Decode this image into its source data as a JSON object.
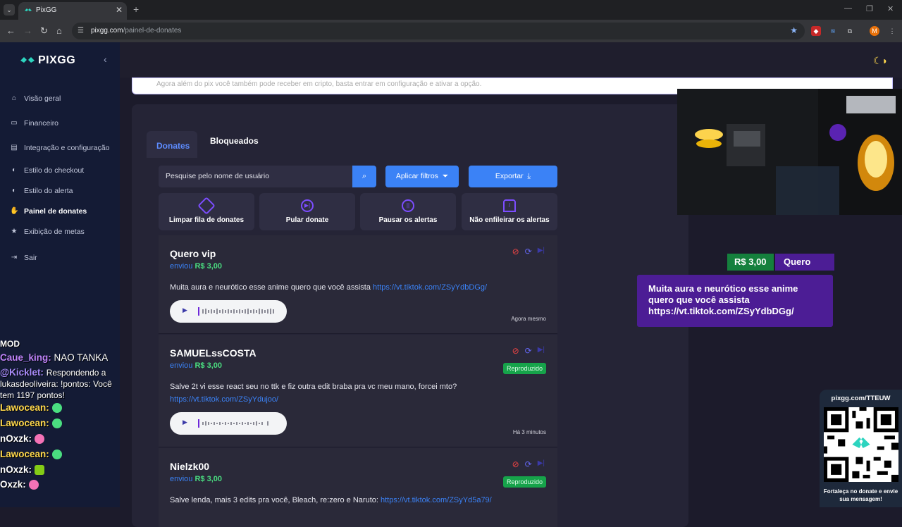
{
  "browser": {
    "tab_title": "PixGG",
    "tab_close": "✕",
    "new_tab": "+",
    "url_domain": "pixgg.com",
    "url_path": "/painel-de-donates",
    "window_minimize": "—",
    "window_restore": "❐",
    "window_close": "✕",
    "profile_initial": "M"
  },
  "sidebar": {
    "brand": "PIXGG",
    "items": [
      {
        "label": "Visão geral",
        "icon": "home-icon"
      },
      {
        "label": "Financeiro",
        "icon": "wallet-icon"
      },
      {
        "label": "Integração e configuração",
        "icon": "settings-icon"
      },
      {
        "label": "Estilo do checkout",
        "icon": "palette-icon"
      },
      {
        "label": "Estilo do alerta",
        "icon": "palette-icon"
      },
      {
        "label": "Painel de donates",
        "icon": "hand-coin-icon"
      },
      {
        "label": "Exibição de metas",
        "icon": "star-icon"
      },
      {
        "label": "Sair",
        "icon": "logout-icon"
      }
    ]
  },
  "chat": {
    "lines": [
      {
        "user": "MOD",
        "text": ""
      },
      {
        "user": "Caue_king:",
        "text": "NAO TANKA"
      },
      {
        "user": "@Kicklet:",
        "text": "Respondendo a lukasdeoliveira: !pontos: Você tem 1197 pontos!"
      },
      {
        "user": "Lawocean:",
        "text": ""
      },
      {
        "user": "Lawocean:",
        "text": ""
      },
      {
        "user": "nOxzk:",
        "text": ""
      },
      {
        "user": "Lawocean:",
        "text": ""
      },
      {
        "user": "nOxzk:",
        "text": ""
      },
      {
        "user": "Oxzk:",
        "text": ""
      }
    ]
  },
  "main": {
    "notice": "Agora além do pix você também pode receber em cripto, basta entrar em configuração e ativar a opção.",
    "tabs": {
      "donates": "Donates",
      "blocked": "Bloqueados"
    },
    "search_placeholder": "Pesquise pelo nome de usuário",
    "filters_label": "Aplicar filtros",
    "export_label": "Exportar",
    "actions": [
      {
        "label": "Limpar fila de donates",
        "icon": "eraser-icon"
      },
      {
        "label": "Pular donate",
        "icon": "skip-icon"
      },
      {
        "label": "Pausar os alertas",
        "icon": "pause-icon"
      },
      {
        "label": "Não enfileirar os alertas",
        "icon": "bell-off-icon"
      }
    ],
    "donates": [
      {
        "name": "Quero vip",
        "sent": "enviou",
        "amount": "R$ 3,00",
        "message": "Muita aura e neurótico esse anime quero que você assista",
        "link": "https://vt.tiktok.com/ZSyYdbDGg/",
        "status": "",
        "time": "Agora mesmo"
      },
      {
        "name": "SAMUELssCOSTA",
        "sent": "enviou",
        "amount": "R$ 3,00",
        "message": "Salve 2t vi esse react seu no ttk e fiz outra edit braba pra vc meu mano, forcei mto?",
        "link": "https://vt.tiktok.com/ZSyYdujoo/",
        "status": "Reproduzido",
        "time": "Há 3 minutos"
      },
      {
        "name": "Nielzk00",
        "sent": "enviou",
        "amount": "R$ 3,00",
        "message": "Salve lenda, mais 3 edits pra você, Bleach, re:zero e Naruto:",
        "link": "https://vt.tiktok.com/ZSyYd5a79/",
        "status": "Reproduzido",
        "time": ""
      }
    ]
  },
  "overlay": {
    "alert_amount": "R$ 3,00",
    "alert_name": "Quero vip",
    "alert_message": "Muita aura e neurótico esse anime quero que você assista https://vt.tiktok.com/ZSyYdbDGg/",
    "qr_url": "pixgg.com/TTEUW",
    "qr_caption": "Fortaleça no donate e envie sua mensagem!"
  },
  "colors": {
    "accent": "#3b82f6",
    "amount": "#4ade80",
    "alert_purple": "#4c1d95",
    "sidebar_bg": "#141b35"
  }
}
